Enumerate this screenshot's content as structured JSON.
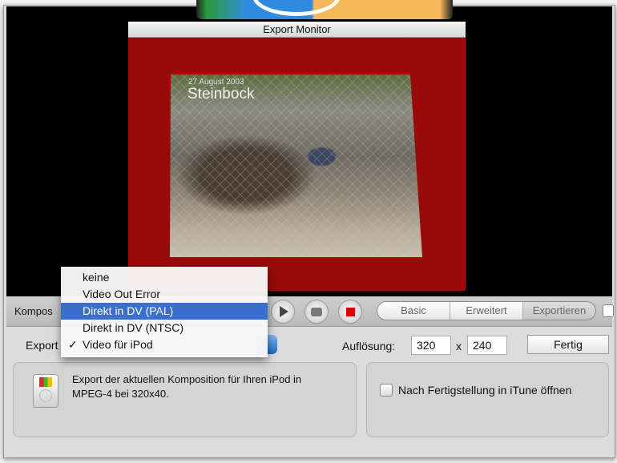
{
  "monitor": {
    "title": "Export Monitor",
    "photo_date": "27 August 2003",
    "photo_title": "Steinbock"
  },
  "toolbar": {
    "komposition_label": "Kompos",
    "tabs": [
      {
        "label": "Basic"
      },
      {
        "label": "Erweitert"
      },
      {
        "label": "Exportieren",
        "selected": true
      }
    ]
  },
  "export": {
    "label": "Export",
    "resolution_label": "Auflösung:",
    "width": "320",
    "x": "x",
    "height": "240",
    "done_button": "Fertig"
  },
  "menu": {
    "items": [
      {
        "label": "keine"
      },
      {
        "label": "Video Out Error"
      },
      {
        "label": "Direkt in DV (PAL)",
        "highlighted": true
      },
      {
        "label": "Direkt in DV (NTSC)"
      },
      {
        "label": "Video für iPod",
        "checked": true
      }
    ],
    "check": "✓"
  },
  "description": {
    "line1": "Export der aktuellen Komposition für Ihren iPod in",
    "line2": "MPEG-4 bei 320x40."
  },
  "option": {
    "label": "Nach Fertigstellung in iTune öffnen",
    "checked": false
  },
  "colors": {
    "highlight": "#3a6fd0",
    "monitor_bg": "#9b0a0a",
    "stop": "#e00000"
  }
}
